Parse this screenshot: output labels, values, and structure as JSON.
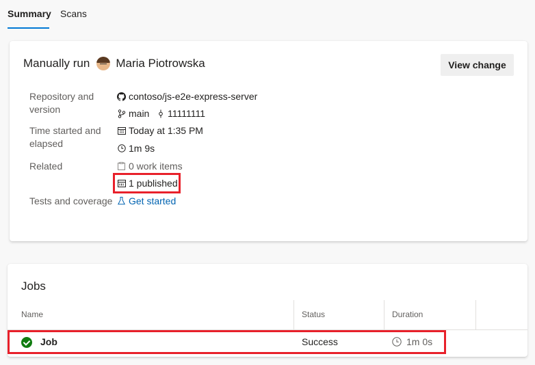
{
  "tabs": [
    {
      "label": "Summary",
      "active": true
    },
    {
      "label": "Scans",
      "active": false
    }
  ],
  "summary": {
    "title_prefix": "Manually run",
    "user_name": "Maria Piotrowska",
    "view_change_label": "View change",
    "repo_label": "Repository and version",
    "repository": "contoso/js-e2e-express-server",
    "branch": "main",
    "commit": "11111111",
    "time_label": "Time started and elapsed",
    "started": "Today at 1:35 PM",
    "elapsed": "1m 9s",
    "related_label": "Related",
    "work_items": "0 work items",
    "published": "1 published",
    "tests_label": "Tests and coverage",
    "get_started": "Get started"
  },
  "jobs": {
    "title": "Jobs",
    "columns": [
      "Name",
      "Status",
      "Duration"
    ],
    "rows": [
      {
        "name": "Job",
        "status": "Success",
        "duration": "1m 0s",
        "status_icon": "success-check-icon"
      }
    ]
  },
  "colors": {
    "accent": "#0078d4",
    "link": "#0063b1",
    "success": "#107c10",
    "highlight": "#e8202a"
  }
}
